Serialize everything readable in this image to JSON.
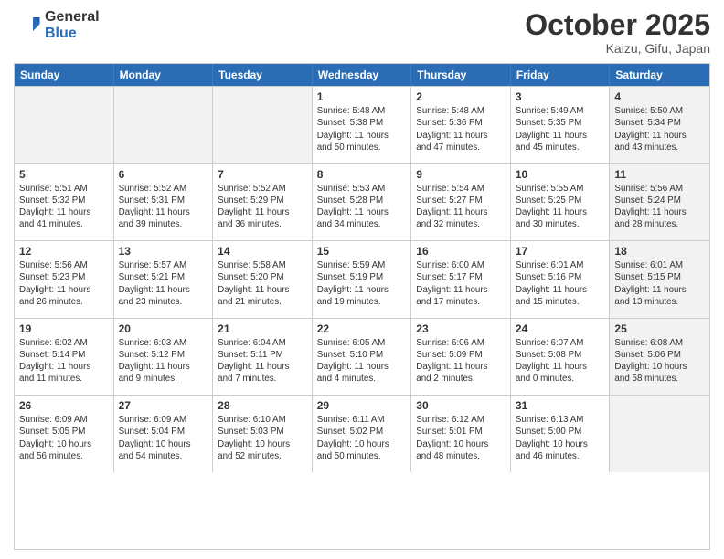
{
  "header": {
    "logo_general": "General",
    "logo_blue": "Blue",
    "month": "October 2025",
    "location": "Kaizu, Gifu, Japan"
  },
  "weekdays": [
    "Sunday",
    "Monday",
    "Tuesday",
    "Wednesday",
    "Thursday",
    "Friday",
    "Saturday"
  ],
  "weeks": [
    [
      {
        "day": "",
        "text": "",
        "shaded": true
      },
      {
        "day": "",
        "text": "",
        "shaded": true
      },
      {
        "day": "",
        "text": "",
        "shaded": true
      },
      {
        "day": "1",
        "text": "Sunrise: 5:48 AM\nSunset: 5:38 PM\nDaylight: 11 hours\nand 50 minutes."
      },
      {
        "day": "2",
        "text": "Sunrise: 5:48 AM\nSunset: 5:36 PM\nDaylight: 11 hours\nand 47 minutes."
      },
      {
        "day": "3",
        "text": "Sunrise: 5:49 AM\nSunset: 5:35 PM\nDaylight: 11 hours\nand 45 minutes."
      },
      {
        "day": "4",
        "text": "Sunrise: 5:50 AM\nSunset: 5:34 PM\nDaylight: 11 hours\nand 43 minutes.",
        "shaded": true
      }
    ],
    [
      {
        "day": "5",
        "text": "Sunrise: 5:51 AM\nSunset: 5:32 PM\nDaylight: 11 hours\nand 41 minutes."
      },
      {
        "day": "6",
        "text": "Sunrise: 5:52 AM\nSunset: 5:31 PM\nDaylight: 11 hours\nand 39 minutes."
      },
      {
        "day": "7",
        "text": "Sunrise: 5:52 AM\nSunset: 5:29 PM\nDaylight: 11 hours\nand 36 minutes."
      },
      {
        "day": "8",
        "text": "Sunrise: 5:53 AM\nSunset: 5:28 PM\nDaylight: 11 hours\nand 34 minutes."
      },
      {
        "day": "9",
        "text": "Sunrise: 5:54 AM\nSunset: 5:27 PM\nDaylight: 11 hours\nand 32 minutes."
      },
      {
        "day": "10",
        "text": "Sunrise: 5:55 AM\nSunset: 5:25 PM\nDaylight: 11 hours\nand 30 minutes."
      },
      {
        "day": "11",
        "text": "Sunrise: 5:56 AM\nSunset: 5:24 PM\nDaylight: 11 hours\nand 28 minutes.",
        "shaded": true
      }
    ],
    [
      {
        "day": "12",
        "text": "Sunrise: 5:56 AM\nSunset: 5:23 PM\nDaylight: 11 hours\nand 26 minutes."
      },
      {
        "day": "13",
        "text": "Sunrise: 5:57 AM\nSunset: 5:21 PM\nDaylight: 11 hours\nand 23 minutes."
      },
      {
        "day": "14",
        "text": "Sunrise: 5:58 AM\nSunset: 5:20 PM\nDaylight: 11 hours\nand 21 minutes."
      },
      {
        "day": "15",
        "text": "Sunrise: 5:59 AM\nSunset: 5:19 PM\nDaylight: 11 hours\nand 19 minutes."
      },
      {
        "day": "16",
        "text": "Sunrise: 6:00 AM\nSunset: 5:17 PM\nDaylight: 11 hours\nand 17 minutes."
      },
      {
        "day": "17",
        "text": "Sunrise: 6:01 AM\nSunset: 5:16 PM\nDaylight: 11 hours\nand 15 minutes."
      },
      {
        "day": "18",
        "text": "Sunrise: 6:01 AM\nSunset: 5:15 PM\nDaylight: 11 hours\nand 13 minutes.",
        "shaded": true
      }
    ],
    [
      {
        "day": "19",
        "text": "Sunrise: 6:02 AM\nSunset: 5:14 PM\nDaylight: 11 hours\nand 11 minutes."
      },
      {
        "day": "20",
        "text": "Sunrise: 6:03 AM\nSunset: 5:12 PM\nDaylight: 11 hours\nand 9 minutes."
      },
      {
        "day": "21",
        "text": "Sunrise: 6:04 AM\nSunset: 5:11 PM\nDaylight: 11 hours\nand 7 minutes."
      },
      {
        "day": "22",
        "text": "Sunrise: 6:05 AM\nSunset: 5:10 PM\nDaylight: 11 hours\nand 4 minutes."
      },
      {
        "day": "23",
        "text": "Sunrise: 6:06 AM\nSunset: 5:09 PM\nDaylight: 11 hours\nand 2 minutes."
      },
      {
        "day": "24",
        "text": "Sunrise: 6:07 AM\nSunset: 5:08 PM\nDaylight: 11 hours\nand 0 minutes."
      },
      {
        "day": "25",
        "text": "Sunrise: 6:08 AM\nSunset: 5:06 PM\nDaylight: 10 hours\nand 58 minutes.",
        "shaded": true
      }
    ],
    [
      {
        "day": "26",
        "text": "Sunrise: 6:09 AM\nSunset: 5:05 PM\nDaylight: 10 hours\nand 56 minutes."
      },
      {
        "day": "27",
        "text": "Sunrise: 6:09 AM\nSunset: 5:04 PM\nDaylight: 10 hours\nand 54 minutes."
      },
      {
        "day": "28",
        "text": "Sunrise: 6:10 AM\nSunset: 5:03 PM\nDaylight: 10 hours\nand 52 minutes."
      },
      {
        "day": "29",
        "text": "Sunrise: 6:11 AM\nSunset: 5:02 PM\nDaylight: 10 hours\nand 50 minutes."
      },
      {
        "day": "30",
        "text": "Sunrise: 6:12 AM\nSunset: 5:01 PM\nDaylight: 10 hours\nand 48 minutes."
      },
      {
        "day": "31",
        "text": "Sunrise: 6:13 AM\nSunset: 5:00 PM\nDaylight: 10 hours\nand 46 minutes."
      },
      {
        "day": "",
        "text": "",
        "shaded": true
      }
    ]
  ]
}
